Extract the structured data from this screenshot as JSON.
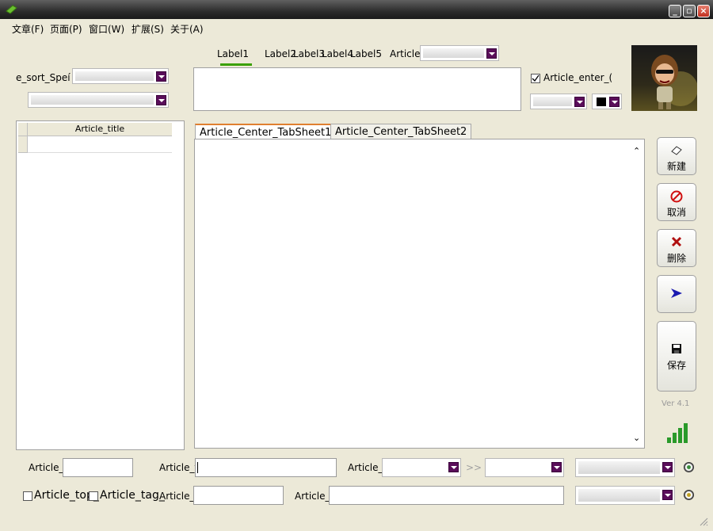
{
  "menu": [
    {
      "label": "文章(F)"
    },
    {
      "label": "页面(P)"
    },
    {
      "label": "窗口(W)"
    },
    {
      "label": "扩展(S)"
    },
    {
      "label": "关于(A)"
    }
  ],
  "top_labels": [
    "Label1",
    "Label2",
    "Label3",
    "Label4",
    "Label5"
  ],
  "article_combo_label": "Article_",
  "sort_label": "e_sort_Speí",
  "enter_checkbox_label": "Article_enter_(",
  "grid": {
    "column_header": "Article_title"
  },
  "tabs": [
    {
      "label": "Article_Center_TabSheet1"
    },
    {
      "label": "Article_Center_TabSheet2"
    }
  ],
  "side_buttons": {
    "new": "新建",
    "cancel": "取消",
    "delete": "删除",
    "save": "保存"
  },
  "version": "Ver 4.1",
  "bottom_row1": {
    "label1": "Article_",
    "label2": "Article_f",
    "label3": "Article_s",
    "arrows": ">>"
  },
  "bottom_row2": {
    "top_check": "Article_top_",
    "tag_check": "Article_tag_",
    "label_a": "Article_a",
    "label_s": "Article_s"
  },
  "colors": {
    "accent_tab": "#e08030",
    "dropdown": "#5a0e5a",
    "tab_underline": "#3aa000"
  }
}
